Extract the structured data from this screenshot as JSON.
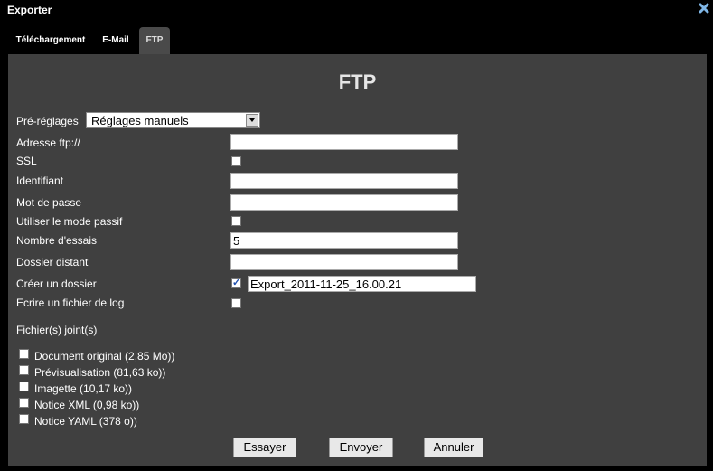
{
  "window": {
    "title": "Exporter",
    "close_icon": "close-icon"
  },
  "tabs": [
    {
      "label": "Téléchargement",
      "active": false
    },
    {
      "label": "E-Mail",
      "active": false
    },
    {
      "label": "FTP",
      "active": true
    }
  ],
  "form": {
    "heading": "FTP",
    "presets": {
      "label": "Pré-réglages",
      "value": "Réglages manuels"
    },
    "ftp_address": {
      "label": "Adresse ftp://",
      "value": ""
    },
    "ssl": {
      "label": "SSL",
      "checked": false
    },
    "username": {
      "label": "Identifiant",
      "value": ""
    },
    "password": {
      "label": "Mot de passe",
      "value": ""
    },
    "passive_mode": {
      "label": "Utiliser le mode passif",
      "checked": false
    },
    "retries": {
      "label": "Nombre d'essais",
      "value": "5"
    },
    "remote_folder": {
      "label": "Dossier distant",
      "value": ""
    },
    "create_folder": {
      "label": "Créer un dossier",
      "checked": true,
      "value": "Export_2011-11-25_16.00.21"
    },
    "log_file": {
      "label": "Ecrire un fichier de log",
      "checked": false
    }
  },
  "attachments": {
    "label": "Fichier(s) joint(s)",
    "items": [
      {
        "label": "Document original (2,85 Mo))",
        "checked": false
      },
      {
        "label": "Prévisualisation (81,63 ko))",
        "checked": false
      },
      {
        "label": "Imagette (10,17 ko))",
        "checked": false
      },
      {
        "label": "Notice XML (0,98 ko))",
        "checked": false
      },
      {
        "label": "Notice YAML (378 o))",
        "checked": false
      }
    ]
  },
  "buttons": {
    "test": "Essayer",
    "send": "Envoyer",
    "cancel": "Annuler"
  },
  "colors": {
    "panel": "#404040",
    "background": "#000000",
    "close_icon": "#7fb6e6"
  }
}
